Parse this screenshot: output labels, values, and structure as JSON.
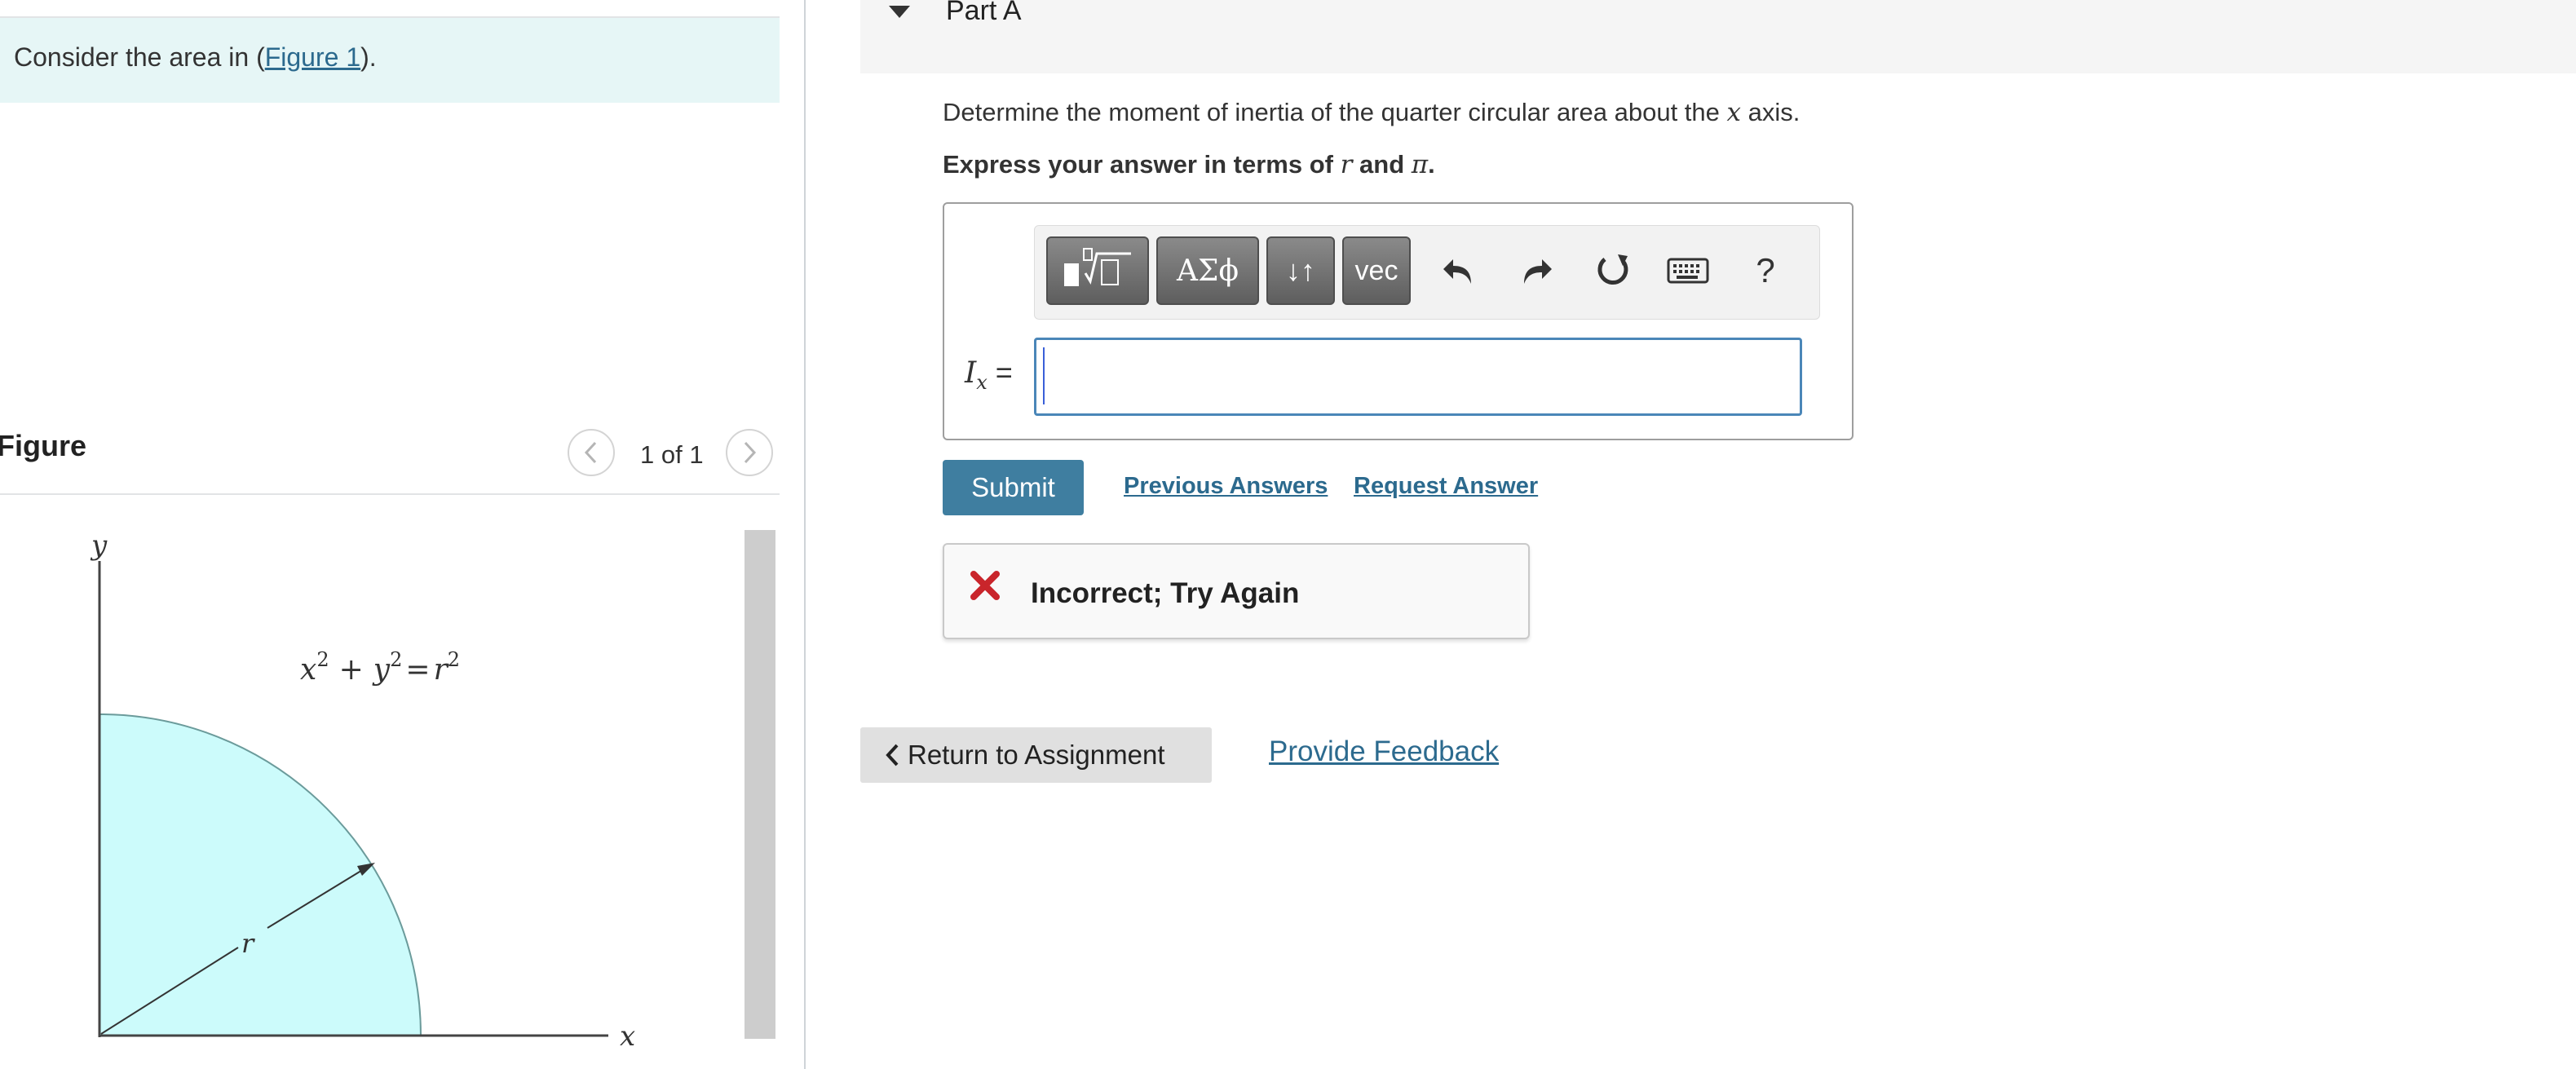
{
  "left_panel": {
    "prompt_prefix": "Consider the area in (",
    "prompt_link": "Figure 1",
    "prompt_suffix": ").",
    "figure_heading": "Figure",
    "figure_counter": "1 of 1",
    "prev_icon": "chevron-left-icon",
    "next_icon": "chevron-right-icon",
    "figure": {
      "axis_y_label": "y",
      "axis_x_label": "x",
      "radius_label": "r",
      "equation": {
        "x": "x",
        "x_exp": "2",
        "plus": "+",
        "y": "y",
        "y_exp": "2",
        "equals": "=",
        "r": "r",
        "r_exp": "2"
      },
      "fill_color": "#ccfbfb"
    }
  },
  "part": {
    "caret_icon": "caret-down-icon",
    "title": "Part A"
  },
  "question": {
    "text_prefix": "Determine the moment of inertia of the quarter circular area about the ",
    "text_var": "x",
    "text_suffix": " axis.",
    "instruction_prefix": "Express your answer in terms of ",
    "instruction_var1": "r",
    "instruction_mid": " and ",
    "instruction_var2": "π",
    "instruction_suffix": "."
  },
  "toolbar": {
    "greek_label": "ΑΣϕ",
    "arrows_label": "↓↑",
    "vec_label": "vec",
    "help_label": "?",
    "icons": [
      "template-icon",
      "greek-icon",
      "arrows-icon",
      "vec-icon",
      "undo-icon",
      "redo-icon",
      "reset-icon",
      "keyboard-icon",
      "help-icon"
    ]
  },
  "answer": {
    "label_var": "I",
    "label_sub": "x",
    "label_eq": "=",
    "value": ""
  },
  "actions": {
    "submit_label": "Submit",
    "previous_answers": "Previous Answers",
    "request_answer": "Request Answer"
  },
  "feedback": {
    "icon": "x-mark-icon",
    "text": "Incorrect; Try Again",
    "icon_color": "#c9252b"
  },
  "footer": {
    "return_label": "Return to Assignment",
    "provide_feedback": "Provide Feedback"
  },
  "colors": {
    "link": "#2c6a8e",
    "submit_bg": "#3f7ea0",
    "prompt_bg": "#e6f6f6",
    "input_border": "#4a86b8"
  }
}
